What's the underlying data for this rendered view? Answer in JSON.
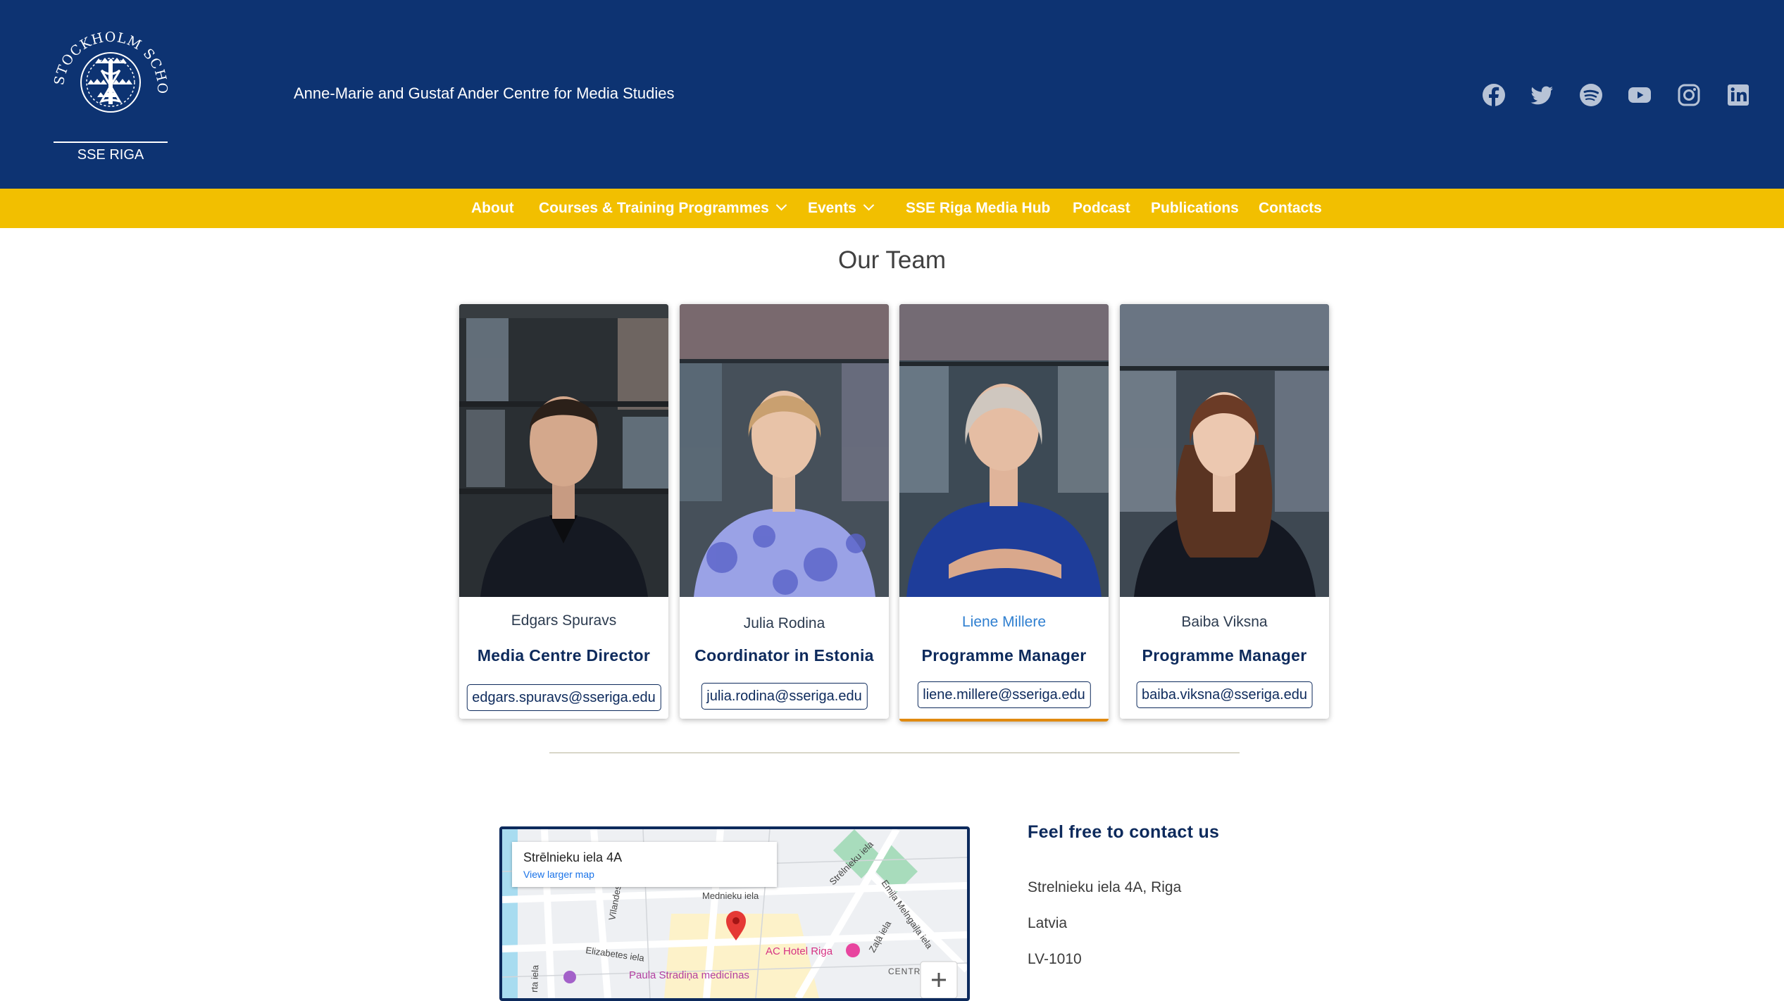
{
  "header": {
    "logo_text_arc": "STOCKHOLM SCHOOL OF ECONOMICS",
    "logo_text_sub": "SSE RIGA",
    "tagline": "Anne-Marie and Gustaf Ander Centre for Media Studies",
    "social_icons": [
      "facebook-icon",
      "twitter-icon",
      "spotify-icon",
      "youtube-icon",
      "instagram-icon",
      "linkedin-icon"
    ]
  },
  "nav": {
    "items": [
      {
        "label": "About",
        "dropdown": false
      },
      {
        "label": "Courses & Training Programmes",
        "dropdown": true
      },
      {
        "label": "Events",
        "dropdown": true
      },
      {
        "label": "SSE Riga Media Hub",
        "dropdown": false
      },
      {
        "label": "Podcast",
        "dropdown": false
      },
      {
        "label": "Publications",
        "dropdown": false
      },
      {
        "label": "Contacts",
        "dropdown": false
      }
    ]
  },
  "team": {
    "title": "Our Team",
    "members": [
      {
        "name": "Edgars Spuravs",
        "role": "Media Centre Director",
        "email": "edgars.spuravs@sseriga.edu"
      },
      {
        "name": "Julia Rodina",
        "role": "Coordinator in Estonia",
        "email": "julia.rodina@sseriga.edu"
      },
      {
        "name": "Liene Millere",
        "role": "Programme Manager",
        "email": "liene.millere@sseriga.edu"
      },
      {
        "name": "Baiba Viksna",
        "role": "Programme Manager",
        "email": "baiba.viksna@sseriga.edu"
      }
    ]
  },
  "map": {
    "address": "Strēlnieku iela 4A",
    "link": "View larger map",
    "streets": [
      "Strēlnieku iela",
      "Mednieku iela",
      "Vīlandes iela",
      "Elizabetes iela",
      "Emiļa Melngaiļa iela",
      "Zaļā iela",
      "Paula Stradiņa medicīnas",
      "AC Hotel Riga",
      "CENTRA",
      "rta iela"
    ]
  },
  "contact": {
    "heading": "Feel free to contact us",
    "address": "Strelnieku iela 4A, Riga",
    "country": "Latvia",
    "postcode": "LV-1010"
  },
  "colors": {
    "header_bg": "#0d3372",
    "nav_bg": "#f2bf00",
    "accent_orange": "#e08a10",
    "text_navy": "#0d2a5c"
  }
}
